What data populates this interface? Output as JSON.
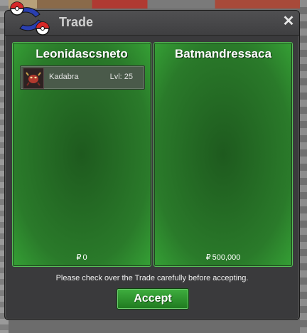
{
  "window": {
    "title": "Trade",
    "close_label": "✕"
  },
  "left_panel": {
    "player_name": "Leonidascsneto",
    "items": [
      {
        "name": "Kadabra",
        "level": "Lvl: 25"
      }
    ],
    "currency_symbol": "₽",
    "money": "0"
  },
  "right_panel": {
    "player_name": "Batmandressaca",
    "items": [],
    "currency_symbol": "₽",
    "money": "500,000"
  },
  "notice": "Please check over the Trade carefully before accepting.",
  "accept_label": "Accept",
  "colors": {
    "panel_green": "#2a7a2a",
    "button_green": "#2f9a2f",
    "window_bg": "#3a3a3c"
  }
}
